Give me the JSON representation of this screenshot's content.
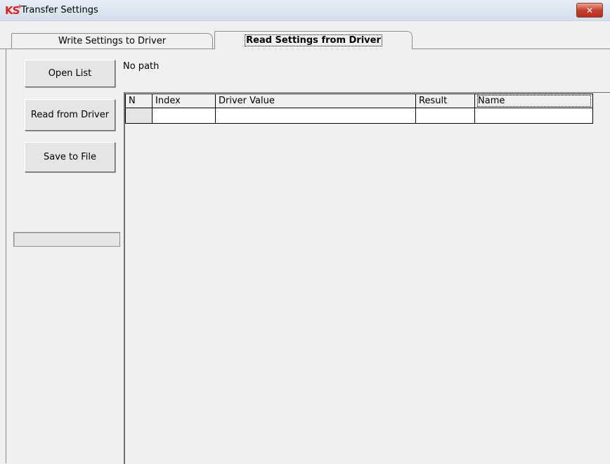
{
  "window": {
    "title": "Transfer Settings",
    "logo": "KS",
    "logo_mark": "+",
    "close_icon": "close-icon"
  },
  "tabs": [
    {
      "label": "Write Settings to Driver",
      "active": false
    },
    {
      "label": "Read Settings from Driver",
      "active": true
    }
  ],
  "buttons": {
    "open_list": "Open List",
    "read_from_driver": "Read from Driver",
    "save_to_file": "Save to File"
  },
  "path_label": "No path",
  "progress": {
    "value": 0
  },
  "grid": {
    "columns": [
      "N",
      "Index",
      "Driver Value",
      "Result",
      "Name"
    ],
    "rows": [
      [
        "",
        "",
        "",
        "",
        ""
      ]
    ]
  },
  "colors": {
    "close_button": "#c6402c",
    "logo": "#e2211c"
  }
}
